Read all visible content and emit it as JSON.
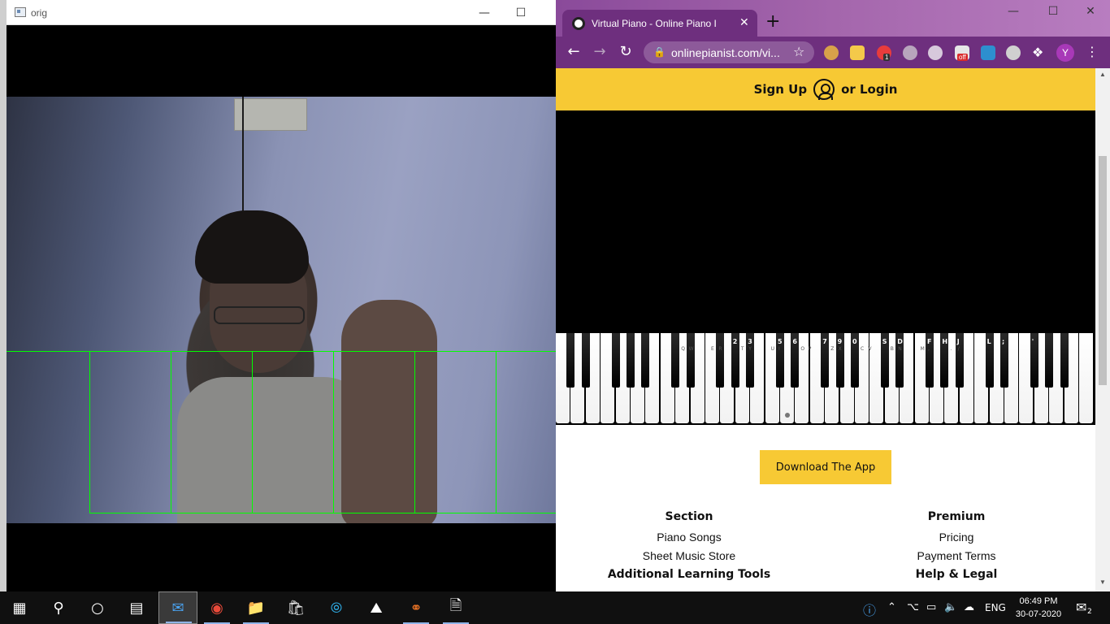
{
  "cv_window": {
    "title": "orig",
    "grid_color": "#00ff00"
  },
  "chrome": {
    "tab_title": "Virtual Piano - Online Piano I",
    "new_tab": "+",
    "url": "onlinepianist.com/vi...",
    "profile_initial": "Y",
    "ext_badge_count": "1",
    "ext_badge_off": "off",
    "accent": "#6e2f7e"
  },
  "site": {
    "sign_up": "Sign Up",
    "login": "or Login",
    "header_color": "#f7c934",
    "black_key_labels": [
      "2",
      "3",
      "5",
      "6",
      "7",
      "9",
      "0",
      "S",
      "D",
      "F",
      "H",
      "J",
      "L",
      ";",
      "'"
    ],
    "white_key_labels": [
      "Q",
      "W",
      "E",
      "R",
      "T",
      "Y",
      "U",
      "I",
      "O",
      "P",
      "Z",
      "X",
      "C",
      "V",
      "B",
      "N",
      "M",
      ",",
      ".",
      "/"
    ],
    "download_button": "Download The App",
    "footer": {
      "col1": {
        "heading": "Section",
        "links": [
          "Piano Songs",
          "Sheet Music Store"
        ],
        "heading2": "Additional Learning Tools"
      },
      "col2": {
        "heading": "Premium",
        "links": [
          "Pricing",
          "Payment Terms"
        ],
        "heading2": "Help & Legal"
      }
    }
  },
  "taskbar": {
    "language": "ENG",
    "time": "06:49 PM",
    "date": "30-07-2020",
    "notifications": "2",
    "apps": [
      "start-icon",
      "search-icon",
      "cortana-icon",
      "task-view-icon",
      "mail-icon",
      "chrome-icon",
      "file-explorer-icon",
      "store-icon",
      "edge-icon",
      "photos-icon",
      "jupyter-icon",
      "document-icon"
    ]
  }
}
